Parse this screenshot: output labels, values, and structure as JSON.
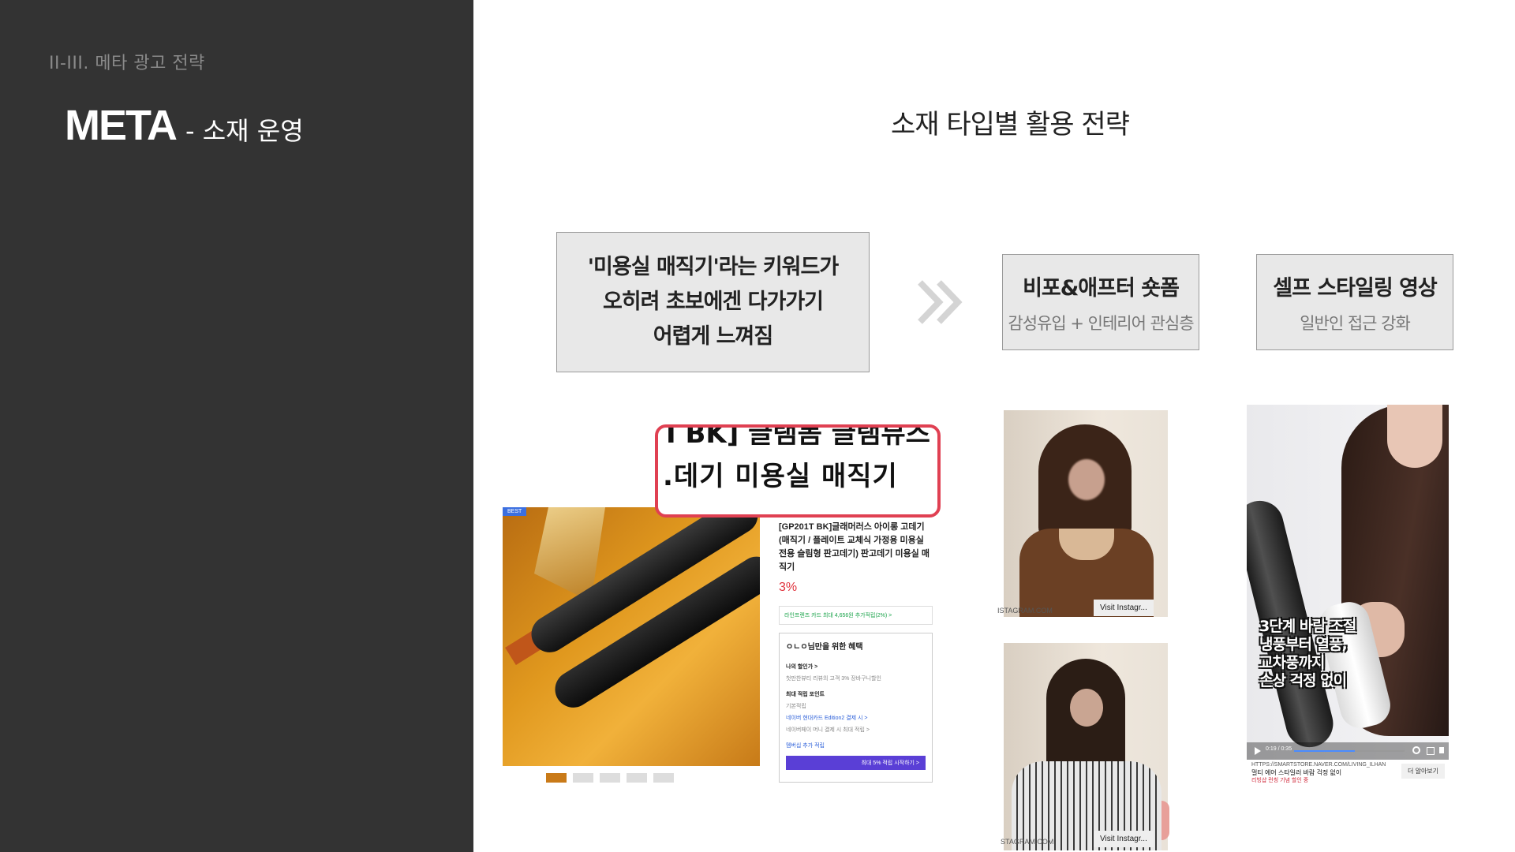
{
  "sidebar": {
    "breadcrumb": "II-III. 메타 광고 전략",
    "title": "META",
    "subtitle": "- 소재 운영"
  },
  "main": {
    "heading": "소재 타입별 활용 전략",
    "problem_box": {
      "line1": "'미용실 매직기'라는 키워드가",
      "line2": "오히려 초보에겐 다가가기",
      "line3": "어렵게 느껴짐"
    },
    "arrow_icon": "double-chevron-right-icon",
    "strategy_boxes": [
      {
        "title": "비포&애프터 숏폼",
        "subtitle": "감성유입 + 인테리어 관심층"
      },
      {
        "title": "셀프 스타일링 영상",
        "subtitle": "일반인 접근 강화"
      }
    ]
  },
  "product_screenshot": {
    "badge": "BEST",
    "zoom_top": "I BK] 글램몸 글램뷰즈 ㄴ",
    "zoom_main": ".데기 미용실 매직기",
    "name": "[GP201T BK]글래머러스 아이롱 고데기 (매직기 / 플레이트 교체식 가정용 미용실 전용 슬림형 판고데기) 판고데기 미용실 매직기",
    "discount": "3%",
    "card_benefit": "라인프렌즈 카드 최대 4,656원 추가적립(2%) >",
    "benefit_title": "ㅇㄴㅇ님만을 위한 혜택",
    "my_discount": "나의 할인가 >",
    "my_discount_detail": "첫만찬뷰티 리뷰의 고객 3% 장바구니할인",
    "max_point": "최대 적립 포인트",
    "basic_point": "기본적립",
    "naver_card": "네이버 현대카드 Edition2 결제 시 >",
    "naver_money": "네이버페이 머니 결제 시 최대 적립 >",
    "member_label": "멤버십 추가 적립",
    "member_btn": "최대 5% 적립 시작하기 >"
  },
  "instagram_cards": [
    {
      "source": "ISTAGRAM.COM",
      "visit": "Visit Instagr..."
    },
    {
      "source": "STAGRAM.COM",
      "visit": "Visit Instagr..."
    }
  ],
  "video_card": {
    "caption": "3단계 바람 조절\n냉풍부터 열풍,\n교차풍까지\n손상 걱정 없이",
    "time": "0:19 / 0:35",
    "url": "HTTPS://SMARTSTORE.NAVER.COM/LIVING_ILHAN",
    "title": "멀티 에어 스타일러 바람 걱정 없이",
    "promo": "리빙샵 런칭 기념 할인 중",
    "more": "더 알아보기",
    "progress": 0.55
  },
  "colors": {
    "sidebar_bg": "#333333",
    "box_bg": "#e8e8e8",
    "zoom_border": "#e04052",
    "discount": "#e0323c"
  }
}
